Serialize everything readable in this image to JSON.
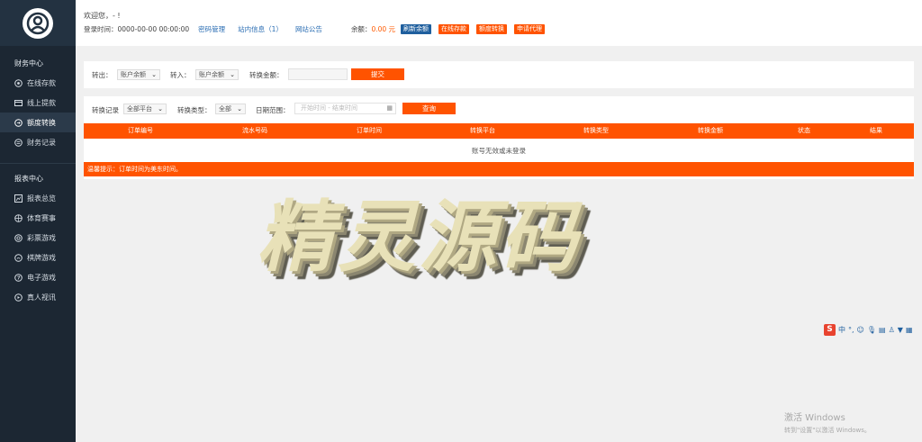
{
  "sidebar": {
    "finance_title": "财务中心",
    "finance_items": [
      {
        "label": "在线存款",
        "icon": "deposit-icon"
      },
      {
        "label": "线上提款",
        "icon": "card-icon"
      },
      {
        "label": "额度转换",
        "icon": "transfer-icon"
      },
      {
        "label": "财务记录",
        "icon": "record-icon"
      }
    ],
    "report_title": "报表中心",
    "report_items": [
      {
        "label": "报表总览",
        "icon": "chart-icon"
      },
      {
        "label": "体育赛事",
        "icon": "ball-icon"
      },
      {
        "label": "彩票游戏",
        "icon": "lottery-icon"
      },
      {
        "label": "棋牌游戏",
        "icon": "chess-icon"
      },
      {
        "label": "电子游戏",
        "icon": "slot-icon"
      },
      {
        "label": "真人视讯",
        "icon": "live-icon"
      }
    ]
  },
  "header": {
    "welcome": "欢迎您，- !",
    "login_time": "登录时间：0000-00-00 00:00:00",
    "password_mgmt": "密码管理",
    "inbox": "站内信息（1）",
    "announcement": "网站公告",
    "balance_label": "余额：",
    "balance_value": "0.00 元",
    "refresh_balance": "刷新余额",
    "online_deposit": "在线存款",
    "quota_transfer": "额度转换",
    "apply_agent": "申请代理"
  },
  "transfer_form": {
    "out_label": "转出：",
    "out_value": "账户余额",
    "in_label": "转入：",
    "in_value": "账户余额",
    "amount_label": "转换金额：",
    "submit": "提交"
  },
  "filter": {
    "record_label": "转换记录",
    "platform_value": "全部平台",
    "type_label": "转换类型：",
    "type_value": "全部",
    "date_label": "日期范围：",
    "date_placeholder": "开始时间 - 结束时间",
    "query": "查询"
  },
  "table": {
    "headers": [
      "订单编号",
      "流水号码",
      "订单时间",
      "转换平台",
      "转换类型",
      "转换金额",
      "状态",
      "结果"
    ],
    "empty_message": "账号无效或未登录"
  },
  "notice": "温馨提示：订单时间为美东时间。",
  "watermark": "精灵源码",
  "ime": {
    "lang": "中"
  },
  "windows": {
    "line1": "激活 Windows",
    "line2": "转到\"设置\"以激活 Windows。"
  },
  "colors": {
    "accent": "#ff5300",
    "sidebar": "#1c2733",
    "link": "#2a6db3"
  }
}
